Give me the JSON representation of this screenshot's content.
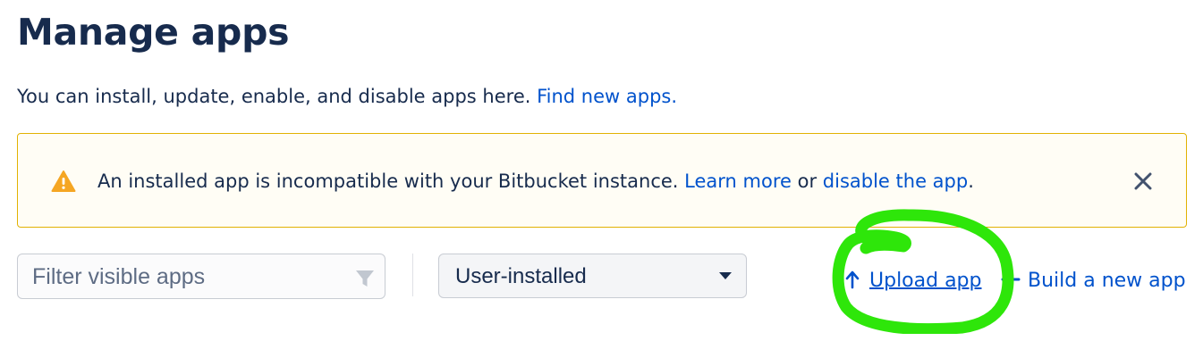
{
  "page": {
    "title": "Manage apps",
    "intro_text": "You can install, update, enable, and disable apps here.",
    "intro_link": "Find new apps."
  },
  "warning": {
    "icon": "warning-icon",
    "message_part1": "An installed app is incompatible with your Bitbucket instance.",
    "learn_more_link": "Learn more",
    "connector": "or",
    "disable_link": "disable the app",
    "trailing": ".",
    "close_icon": "close-icon",
    "colors": {
      "border": "#e2b203",
      "icon": "#f5a623"
    }
  },
  "toolbar": {
    "filter_placeholder": "Filter visible apps",
    "filter_icon": "filter-icon",
    "select_value": "User-installed",
    "select_caret": "chevron-down-icon",
    "upload_label": "Upload app",
    "upload_icon": "upload-icon",
    "build_label": "Build a new app",
    "build_icon": "plus-icon"
  },
  "annotation": {
    "color": "#2ee60a"
  },
  "colors": {
    "link": "#0052cc",
    "text": "#172b4d"
  }
}
